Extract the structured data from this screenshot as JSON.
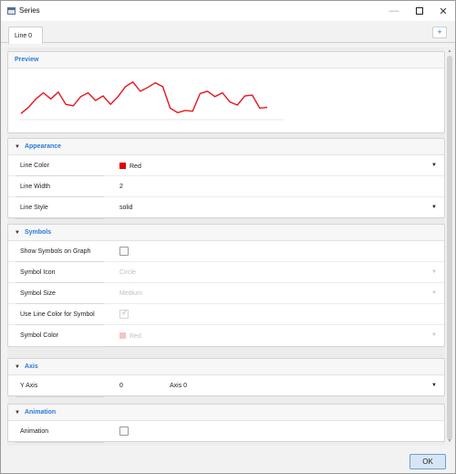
{
  "window": {
    "title": "Series"
  },
  "tabs": [
    {
      "label": "Line 0"
    }
  ],
  "add_tab_label": "+",
  "sections": {
    "preview": {
      "title": "Preview"
    },
    "appearance": {
      "title": "Appearance",
      "line_color_label": "Line Color",
      "line_color_value": "Red",
      "line_width_label": "Line Width",
      "line_width_value": "2",
      "line_style_label": "Line Style",
      "line_style_value": "solid"
    },
    "symbols": {
      "title": "Symbols",
      "show_label": "Show Symbols on Graph",
      "icon_label": "Symbol Icon",
      "icon_value": "Circle",
      "size_label": "Symbol Size",
      "size_value": "Medium",
      "use_line_color_label": "Use Line Color for Symbol",
      "color_label": "Symbol Color",
      "color_value": "Red"
    },
    "axis": {
      "title": "Axis",
      "y_axis_label": "Y Axis",
      "y_axis_index": "0",
      "y_axis_value": "Axis 0"
    },
    "animation": {
      "title": "Animation",
      "animation_label": "Animation"
    }
  },
  "ok_label": "OK",
  "colors": {
    "accent": "#2a7ad5",
    "line": "#e8141e",
    "swatch_red": "#dd0000",
    "swatch_red_dim": "#f4c4c4"
  },
  "icons": {
    "window": "window-icon",
    "caret": "caret-down-icon",
    "dropdown": "dropdown-arrow-icon",
    "check": "checkmark-icon"
  },
  "preview_series": [
    8,
    16,
    27,
    35,
    27,
    36,
    20,
    18,
    30,
    35,
    25,
    31,
    20,
    30,
    43,
    49,
    37,
    42,
    48,
    43,
    15,
    9,
    12,
    11,
    34,
    37,
    30,
    35,
    23,
    19,
    31,
    32,
    15,
    16
  ]
}
